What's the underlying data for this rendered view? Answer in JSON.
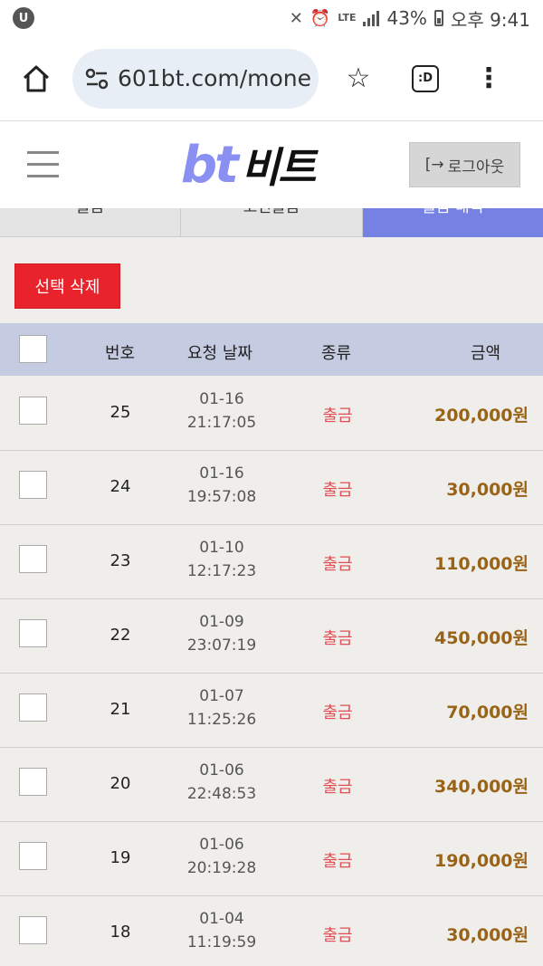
{
  "statusbar": {
    "app_badge": "U",
    "network": "LTE",
    "battery": "43%",
    "time": "오후 9:41"
  },
  "browser": {
    "url": "601bt.com/mone",
    "tabs_label": ":D"
  },
  "site": {
    "logo_latin": "bt",
    "logo_korean": "비트",
    "logout_label": "로그아웃"
  },
  "tabs": [
    {
      "label": "출금"
    },
    {
      "label": "코인출금"
    },
    {
      "label": "출금 내역"
    }
  ],
  "delete_label": "선택 삭제",
  "table": {
    "headers": {
      "num": "번호",
      "date": "요청 날짜",
      "kind": "종류",
      "amount": "금액"
    },
    "rows": [
      {
        "num": "25",
        "date": "01-16",
        "time": "21:17:05",
        "kind": "출금",
        "amount": "200,000원"
      },
      {
        "num": "24",
        "date": "01-16",
        "time": "19:57:08",
        "kind": "출금",
        "amount": "30,000원"
      },
      {
        "num": "23",
        "date": "01-10",
        "time": "12:17:23",
        "kind": "출금",
        "amount": "110,000원"
      },
      {
        "num": "22",
        "date": "01-09",
        "time": "23:07:19",
        "kind": "출금",
        "amount": "450,000원"
      },
      {
        "num": "21",
        "date": "01-07",
        "time": "11:25:26",
        "kind": "출금",
        "amount": "70,000원"
      },
      {
        "num": "20",
        "date": "01-06",
        "time": "22:48:53",
        "kind": "출금",
        "amount": "340,000원"
      },
      {
        "num": "19",
        "date": "01-06",
        "time": "20:19:28",
        "kind": "출금",
        "amount": "190,000원"
      },
      {
        "num": "18",
        "date": "01-04",
        "time": "11:19:59",
        "kind": "출금",
        "amount": "30,000원"
      }
    ]
  },
  "colors": {
    "accent": "#7681e4",
    "danger": "#e8232b",
    "amount": "#9a6418",
    "kind": "#e04d55"
  }
}
